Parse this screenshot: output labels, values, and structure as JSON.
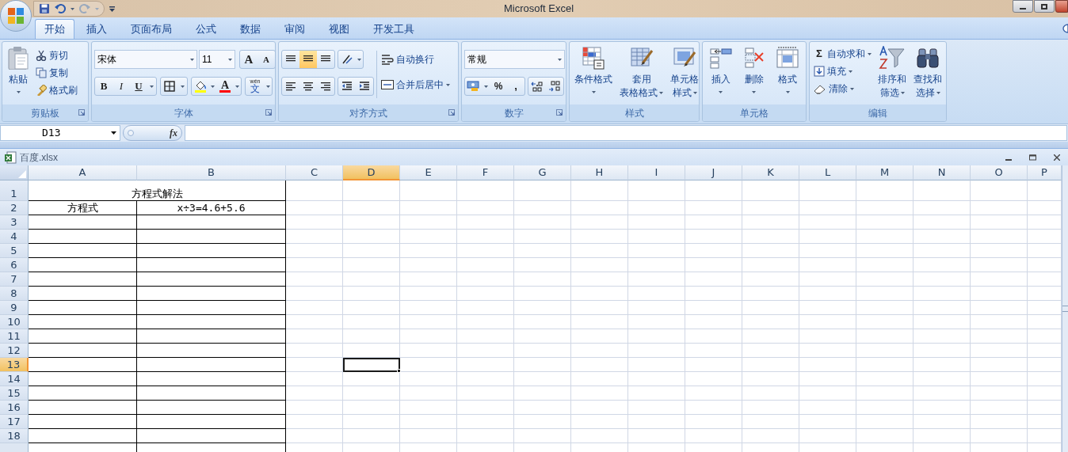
{
  "window": {
    "title": "Microsoft Excel"
  },
  "tabs": [
    {
      "label": "开始",
      "selected": true
    },
    {
      "label": "插入",
      "selected": false
    },
    {
      "label": "页面布局",
      "selected": false
    },
    {
      "label": "公式",
      "selected": false
    },
    {
      "label": "数据",
      "selected": false
    },
    {
      "label": "审阅",
      "selected": false
    },
    {
      "label": "视图",
      "selected": false
    },
    {
      "label": "开发工具",
      "selected": false
    }
  ],
  "ribbon": [
    {
      "label": "剪贴板",
      "paste": "粘贴",
      "small": [
        "剪切",
        "复制",
        "格式刷"
      ]
    },
    {
      "label": "字体",
      "font_name": "宋体",
      "font_size": "11",
      "grow": "A",
      "shrink": "A",
      "bold": "B",
      "italic": "I",
      "underline": "U",
      "font_color": "A",
      "phonetic_top": "wén",
      "phonetic": "文"
    },
    {
      "label": "对齐方式",
      "vertical": [
        {
          "selected": false
        },
        {
          "selected": true
        },
        {
          "selected": false
        }
      ],
      "wrap": "自动换行",
      "merge": "合并后居中"
    },
    {
      "label": "数字",
      "format": "常规",
      "percent": "%",
      "comma": ","
    },
    {
      "label": "样式",
      "large": [
        {
          "lines": [
            "条件格式"
          ]
        },
        {
          "lines": [
            "套用",
            "表格格式"
          ]
        },
        {
          "lines": [
            "单元格",
            "样式"
          ]
        }
      ]
    },
    {
      "label": "单元格",
      "large": [
        {
          "lines": [
            "插入"
          ]
        },
        {
          "lines": [
            "删除"
          ]
        },
        {
          "lines": [
            "格式"
          ]
        }
      ]
    },
    {
      "label": "编辑",
      "sum_sign": "Σ",
      "small": [
        "自动求和",
        "填充",
        "清除"
      ],
      "large": [
        {
          "lines": [
            "排序和",
            "筛选"
          ]
        },
        {
          "lines": [
            "查找和",
            "选择"
          ]
        }
      ]
    }
  ],
  "formula_bar": {
    "name_box": "D13",
    "fx": "fx"
  },
  "workbook": {
    "title": "百度.xlsx"
  },
  "sheet": {
    "columns": [
      {
        "label": "A",
        "selected": false
      },
      {
        "label": "B",
        "selected": false
      },
      {
        "label": "C",
        "selected": false
      },
      {
        "label": "D",
        "selected": true
      },
      {
        "label": "E",
        "selected": false
      },
      {
        "label": "F",
        "selected": false
      },
      {
        "label": "G",
        "selected": false
      },
      {
        "label": "H",
        "selected": false
      },
      {
        "label": "I",
        "selected": false
      },
      {
        "label": "J",
        "selected": false
      },
      {
        "label": "K",
        "selected": false
      },
      {
        "label": "L",
        "selected": false
      },
      {
        "label": "M",
        "selected": false
      },
      {
        "label": "N",
        "selected": false
      },
      {
        "label": "O",
        "selected": false
      },
      {
        "label": "P",
        "selected": false
      }
    ],
    "rows": [
      {
        "label": "1",
        "selected": false,
        "cells": [
          {
            "text": "方程式解法",
            "merged": true
          }
        ]
      },
      {
        "label": "2",
        "selected": false,
        "cells": [
          {
            "text": "方程式",
            "merged": false
          },
          {
            "text": "x÷3=4.6+5.6",
            "merged": false
          }
        ]
      },
      {
        "label": "3",
        "selected": false
      },
      {
        "label": "4",
        "selected": false
      },
      {
        "label": "5",
        "selected": false
      },
      {
        "label": "6",
        "selected": false
      },
      {
        "label": "7",
        "selected": false
      },
      {
        "label": "8",
        "selected": false
      },
      {
        "label": "9",
        "selected": false
      },
      {
        "label": "10",
        "selected": false
      },
      {
        "label": "11",
        "selected": false
      },
      {
        "label": "12",
        "selected": false
      },
      {
        "label": "13",
        "selected": true
      },
      {
        "label": "14",
        "selected": false
      },
      {
        "label": "15",
        "selected": false
      },
      {
        "label": "16",
        "selected": false
      },
      {
        "label": "17",
        "selected": false
      },
      {
        "label": "18",
        "selected": false
      }
    ]
  }
}
